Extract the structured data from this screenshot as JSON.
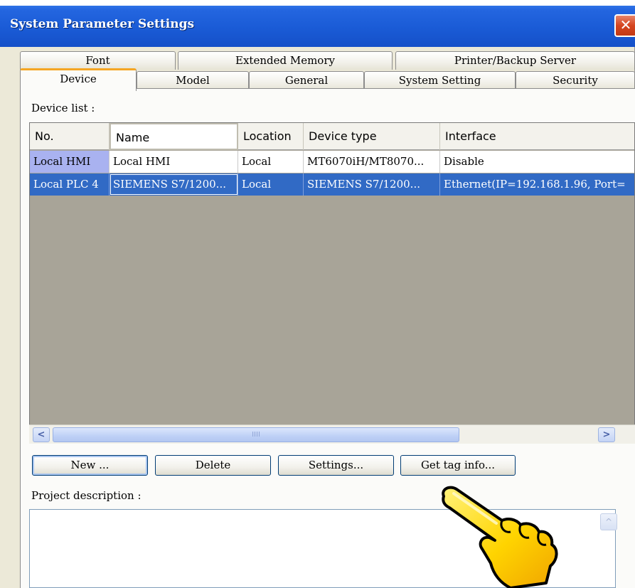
{
  "window": {
    "title": "System Parameter Settings",
    "close_glyph": "✕"
  },
  "tabs": {
    "back_row": [
      "Font",
      "Extended Memory",
      "Printer/Backup Server"
    ],
    "front_row": [
      "Device",
      "Model",
      "General",
      "System Setting",
      "Security"
    ],
    "active": "Device"
  },
  "device_list": {
    "label": "Device list :",
    "columns": [
      "No.",
      "Name",
      "Location",
      "Device type",
      "Interface"
    ],
    "rows": [
      [
        "Local HMI",
        "Local HMI",
        "Local",
        "MT6070iH/MT8070...",
        "Disable"
      ],
      [
        "Local PLC 4",
        "SIEMENS S7/1200...",
        "Local",
        "SIEMENS S7/1200...",
        "Ethernet(IP=192.168.1.96, Port="
      ]
    ],
    "selected_row": 1
  },
  "scrollbar": {
    "left_arrow": "<",
    "right_arrow": ">",
    "thumb_grip": "IIII"
  },
  "buttons": {
    "new": "New ...",
    "delete": "Delete",
    "settings": "Settings...",
    "get_tag_info": "Get tag info..."
  },
  "project": {
    "label": "Project description :",
    "value": "",
    "scroll_up": "^"
  },
  "icons": {
    "pointing_hand": "pointing-hand-icon"
  },
  "colors": {
    "title_bar": "#2466e0",
    "selection": "#316ac5",
    "active_tab_accent": "#f5a623",
    "highlight_cell": "#a9b2f0",
    "grid_background": "#a8a498"
  }
}
